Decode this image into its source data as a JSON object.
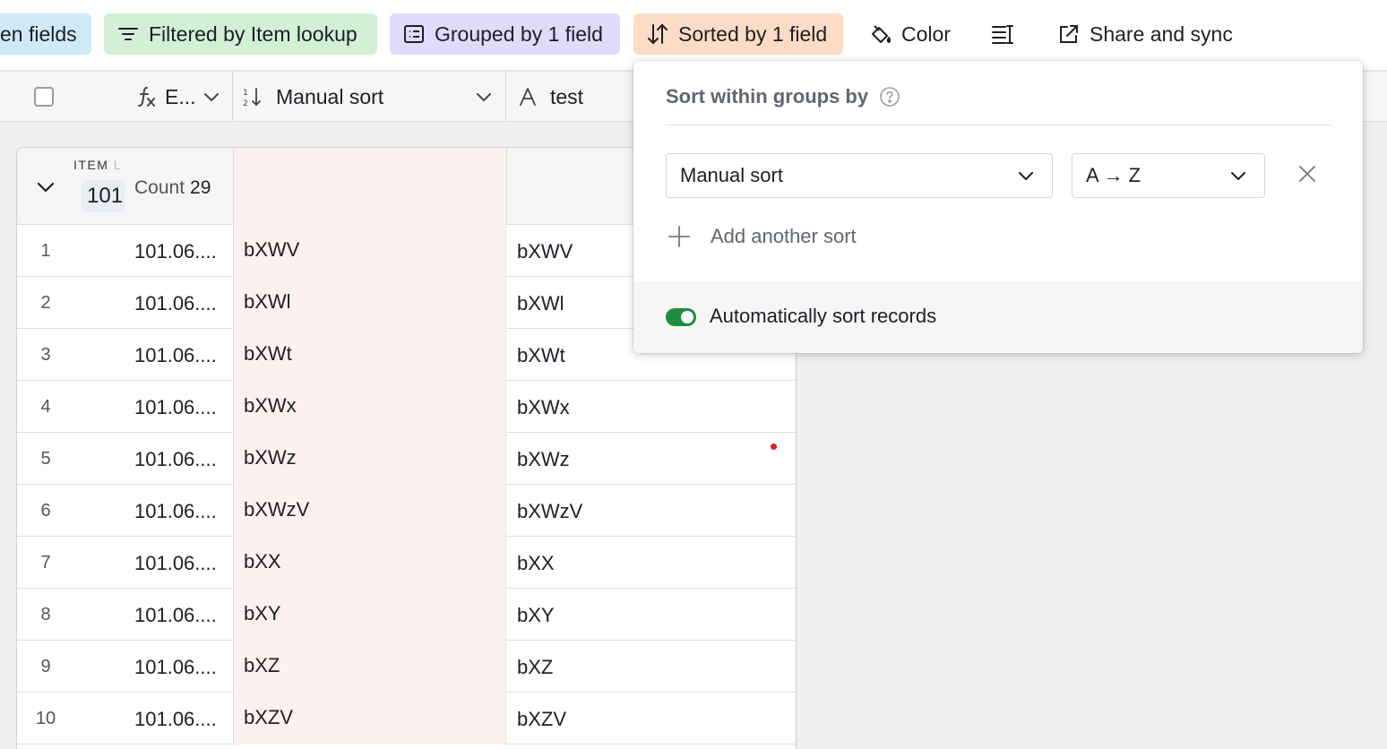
{
  "toolbar": {
    "hidden_fields": "en fields",
    "filter": "Filtered by Item lookup",
    "group": "Grouped by 1 field",
    "sort": "Sorted by 1 field",
    "color": "Color",
    "share": "Share and sync",
    "colors": {
      "hidden_bg": "#cfeaf6",
      "filter_bg": "#d1f0d6",
      "group_bg": "#e0dafb",
      "sort_bg": "#fddcc5"
    }
  },
  "columns": {
    "formula_label": "E...",
    "manual_sort_label": "Manual sort",
    "test_label": "test"
  },
  "group": {
    "label": "ITEM",
    "label_faded": "L",
    "value": "101",
    "value_faded": ".",
    "count_label": "Count",
    "count": "29"
  },
  "rows": [
    {
      "num": "1",
      "e": "101.06....",
      "manual": "bXWV",
      "test": "bXWV"
    },
    {
      "num": "2",
      "e": "101.06....",
      "manual": "bXWl",
      "test": "bXWl"
    },
    {
      "num": "3",
      "e": "101.06....",
      "manual": "bXWt",
      "test": "bXWt"
    },
    {
      "num": "4",
      "e": "101.06....",
      "manual": "bXWx",
      "test": "bXWx"
    },
    {
      "num": "5",
      "e": "101.06....",
      "manual": "bXWz",
      "test": "bXWz"
    },
    {
      "num": "6",
      "e": "101.06....",
      "manual": "bXWzV",
      "test": "bXWzV"
    },
    {
      "num": "7",
      "e": "101.06....",
      "manual": "bXX",
      "test": "bXX"
    },
    {
      "num": "8",
      "e": "101.06....",
      "manual": "bXY",
      "test": "bXY"
    },
    {
      "num": "9",
      "e": "101.06....",
      "manual": "bXZ",
      "test": "bXZ"
    },
    {
      "num": "10",
      "e": "101.06....",
      "manual": "bXZV",
      "test": "bXZV"
    }
  ],
  "sort_popover": {
    "title": "Sort within groups by",
    "field": "Manual sort",
    "direction": "A → Z",
    "add_sort": "Add another sort",
    "auto_sort_label": "Automatically sort records",
    "auto_sort_enabled": true,
    "toggle_color": "#1e8e3e"
  }
}
